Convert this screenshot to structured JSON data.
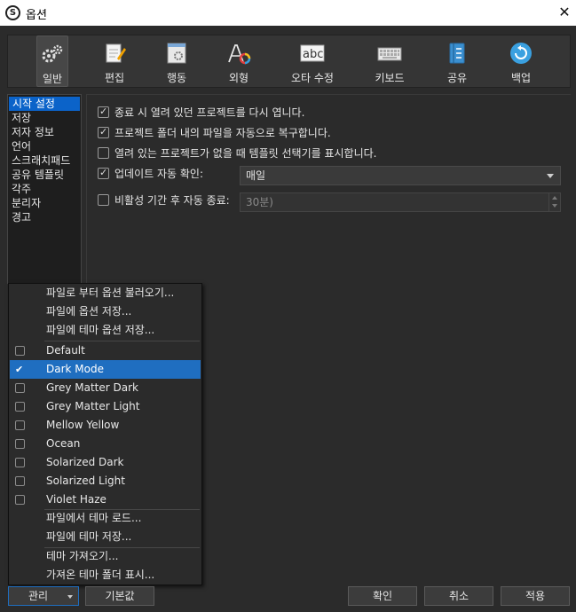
{
  "window": {
    "title": "옵션",
    "icon": "scrivener-s-icon",
    "close_glyph": "✕"
  },
  "toolbar": {
    "items": [
      {
        "label": "일반",
        "icon": "gears-icon"
      },
      {
        "label": "편집",
        "icon": "pencil-pad-icon"
      },
      {
        "label": "행동",
        "icon": "gear-doc-icon"
      },
      {
        "label": "외형",
        "icon": "font-color-icon"
      },
      {
        "label": "오타 수정",
        "icon": "abc-icon"
      },
      {
        "label": "키보드",
        "icon": "keyboard-icon"
      },
      {
        "label": "공유",
        "icon": "notebook-icon"
      },
      {
        "label": "백업",
        "icon": "backup-circle-icon"
      }
    ],
    "active_index": 0
  },
  "sidebar": {
    "items": [
      "시작 설정",
      "저장",
      "저자 정보",
      "언어",
      "스크래치패드",
      "공유 템플릿",
      "각주",
      "분리자",
      "경고"
    ],
    "selected_index": 0
  },
  "general": {
    "opt1": {
      "label": "종료 시 열려 있던 프로젝트를 다시 엽니다.",
      "checked": true
    },
    "opt2": {
      "label": "프로젝트 폴더 내의 파일을 자동으로 복구합니다.",
      "checked": true
    },
    "opt3": {
      "label": "열려 있는 프로젝트가 없을 때 템플릿 선택기를 표시합니다.",
      "checked": false
    },
    "opt4": {
      "label": "업데이트 자동 확인:",
      "checked": true,
      "value": "매일"
    },
    "opt5": {
      "label": "비활성 기간 후 자동 종료:",
      "checked": false,
      "value": "30분)"
    }
  },
  "menu": {
    "top_items": [
      "파일로 부터 옵션 불러오기...",
      "파일에 옵션 저장...",
      "파일에 테마 옵션 저장..."
    ],
    "themes": [
      "Default",
      "Dark Mode",
      "Grey Matter Dark",
      "Grey Matter Light",
      "Mellow Yellow",
      "Ocean",
      "Solarized Dark",
      "Solarized Light",
      "Violet Haze"
    ],
    "selected_theme_index": 1,
    "theme_actions": [
      "파일에서 테마 로드...",
      "파일에 테마 저장..."
    ],
    "bottom_items": [
      "테마 가져오기...",
      "가져온 테마 폴더 표시..."
    ]
  },
  "buttons": {
    "manage": "관리",
    "defaults": "기본값",
    "ok": "확인",
    "cancel": "취소",
    "apply": "적용"
  },
  "colors": {
    "accent": "#1f6ec0",
    "selection": "#0b63c9",
    "background": "#2b2b2b"
  }
}
